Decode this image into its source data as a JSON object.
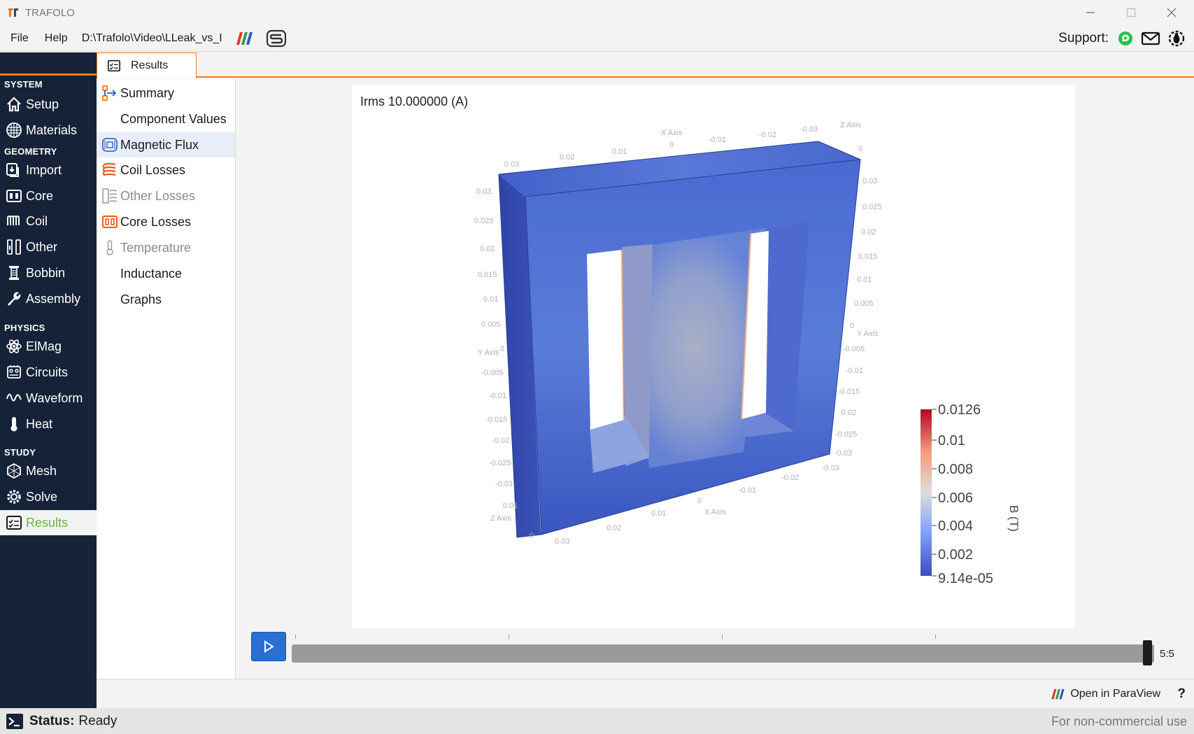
{
  "window": {
    "title": "TRAFOLO"
  },
  "menu": {
    "file": "File",
    "help": "Help",
    "path": "D:\\Trafolo\\Video\\LLeak_vs_I"
  },
  "support": {
    "label": "Support:"
  },
  "sidebar": {
    "sections": [
      "SYSTEM",
      "GEOMETRY",
      "PHYSICS",
      "STUDY"
    ],
    "items": [
      {
        "label": "Setup",
        "icon": "home-icon"
      },
      {
        "label": "Materials",
        "icon": "materials-grid-icon"
      },
      {
        "label": "Import",
        "icon": "import-icon"
      },
      {
        "label": "Core",
        "icon": "core-icon"
      },
      {
        "label": "Coil",
        "icon": "coil-icon"
      },
      {
        "label": "Other",
        "icon": "other-icon"
      },
      {
        "label": "Bobbin",
        "icon": "bobbin-icon"
      },
      {
        "label": "Assembly",
        "icon": "wrench-icon"
      },
      {
        "label": "ElMag",
        "icon": "atom-icon"
      },
      {
        "label": "Circuits",
        "icon": "circuits-icon"
      },
      {
        "label": "Waveform",
        "icon": "waveform-icon"
      },
      {
        "label": "Heat",
        "icon": "thermometer-icon"
      },
      {
        "label": "Mesh",
        "icon": "mesh-icon"
      },
      {
        "label": "Solve",
        "icon": "solve-gear-icon"
      },
      {
        "label": "Results",
        "icon": "results-icon"
      }
    ],
    "active": "Results"
  },
  "tab": {
    "label": "Results"
  },
  "results_list": {
    "items": [
      {
        "label": "Summary",
        "icon": "summary-tree-icon",
        "state": "normal"
      },
      {
        "label": "Component Values",
        "icon": "",
        "state": "normal"
      },
      {
        "label": "Magnetic Flux",
        "icon": "magnetic-flux-icon",
        "state": "selected"
      },
      {
        "label": "Coil Losses",
        "icon": "coil-losses-icon",
        "state": "normal"
      },
      {
        "label": "Other Losses",
        "icon": "other-losses-icon",
        "state": "disabled"
      },
      {
        "label": "Core Losses",
        "icon": "core-losses-icon",
        "state": "normal"
      },
      {
        "label": "Temperature",
        "icon": "thermometer-icon",
        "state": "disabled"
      },
      {
        "label": "Inductance",
        "icon": "",
        "state": "normal"
      },
      {
        "label": "Graphs",
        "icon": "",
        "state": "normal"
      }
    ]
  },
  "render": {
    "title": "Irms 10.000000 (A)",
    "colorbar": {
      "title": "B (T)",
      "ticks": [
        "0.0126",
        "0.01",
        "0.008",
        "0.006",
        "0.004",
        "0.002",
        "9.14e-05"
      ]
    },
    "axes": {
      "left_y_label": "Y Axis",
      "left_y_ticks": [
        "0.03",
        "0.025",
        "0.02",
        "0.015",
        "0.01",
        "0.005",
        "0",
        "-0.005",
        "-0.01",
        "-0.015",
        "-0.02",
        "-0.025",
        "-0.03"
      ],
      "left_z_label": "Z Axis",
      "left_z_ticks": [
        "0.01",
        "0"
      ],
      "top_x_label": "X Axis",
      "top_x_ticks": [
        "0.03",
        "0.02",
        "0.01",
        "0",
        "-0.01",
        "-0.02",
        "-0.03"
      ],
      "top_z_label": "Z Axis",
      "top_z_ticks": [
        "0"
      ],
      "right_y_label": "Y Axis",
      "right_y_ticks": [
        "0.03",
        "0.025",
        "0.02",
        "0.015",
        "0.01",
        "0.005",
        "0",
        "-0.005",
        "-0.01",
        "-0.015",
        "-0.02",
        "-0.025",
        "-0.03",
        "-0.03"
      ],
      "bottom_x_label": "X Axis",
      "bottom_x_ticks": [
        "0.03",
        "0.02",
        "0.01",
        "0",
        "-0.01",
        "-0.02"
      ]
    }
  },
  "player": {
    "value": "5:5",
    "progress": 1.0
  },
  "bottom": {
    "paraview": "Open in ParaView",
    "help": "?"
  },
  "status": {
    "label": "Status:",
    "value": "Ready",
    "right": "For non-commercial use"
  },
  "colors": {
    "sidebar_bg": "#152238",
    "accent_orange": "#f07a22",
    "active_green": "#6db33f",
    "play_blue": "#2a6fd6"
  }
}
